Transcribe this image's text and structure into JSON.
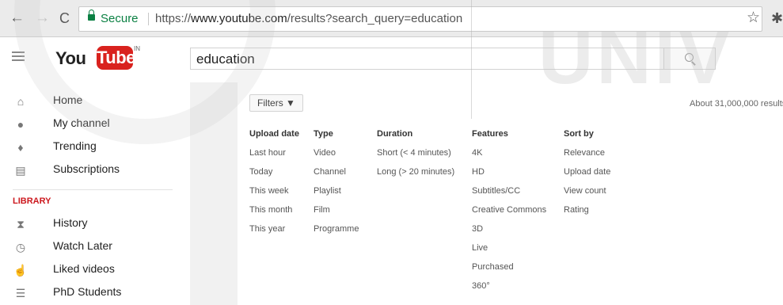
{
  "browser": {
    "secure_label": "Secure",
    "url_scheme": "https://",
    "url_domain": "www.youtube.com",
    "url_path": "/results?search_query=education"
  },
  "header": {
    "logo_you": "You",
    "logo_tube": "Tube",
    "logo_region": "IN",
    "search_value": "education"
  },
  "sidebar": {
    "items": [
      {
        "label": "Home",
        "icon": "home-icon"
      },
      {
        "label": "My channel",
        "icon": "channel-icon"
      },
      {
        "label": "Trending",
        "icon": "trending-icon"
      },
      {
        "label": "Subscriptions",
        "icon": "subscriptions-icon"
      }
    ],
    "library_heading": "LIBRARY",
    "library_items": [
      {
        "label": "History",
        "icon": "history-icon"
      },
      {
        "label": "Watch Later",
        "icon": "watch-later-icon"
      },
      {
        "label": "Liked videos",
        "icon": "liked-icon"
      },
      {
        "label": "PhD Students",
        "icon": "playlist-icon"
      }
    ]
  },
  "filters": {
    "button_label": "Filters ▼",
    "results_count": "About 31,000,000 results",
    "columns": [
      {
        "heading": "Upload date",
        "options": [
          "Last hour",
          "Today",
          "This week",
          "This month",
          "This year"
        ]
      },
      {
        "heading": "Type",
        "options": [
          "Video",
          "Channel",
          "Playlist",
          "Film",
          "Programme"
        ]
      },
      {
        "heading": "Duration",
        "options": [
          "Short (< 4 minutes)",
          "Long (> 20 minutes)"
        ]
      },
      {
        "heading": "Features",
        "options": [
          "4K",
          "HD",
          "Subtitles/CC",
          "Creative Commons",
          "3D",
          "Live",
          "Purchased",
          "360°"
        ]
      },
      {
        "heading": "Sort by",
        "options": [
          "Relevance",
          "Upload date",
          "View count",
          "Rating"
        ]
      }
    ]
  },
  "watermark": {
    "text": "UNIV"
  },
  "colors": {
    "brand_red": "#d9221e",
    "secure_green": "#0b8043",
    "library_red": "#cc181e"
  }
}
